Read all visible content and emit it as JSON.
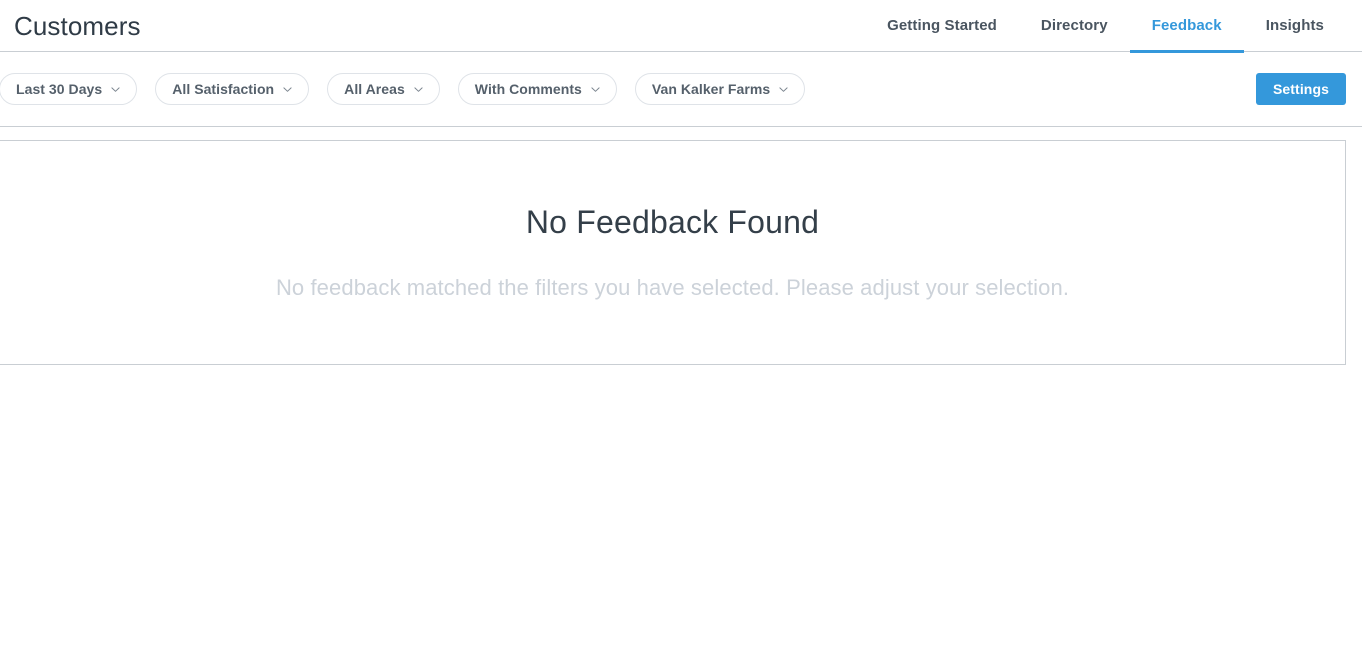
{
  "header": {
    "title": "Customers",
    "tabs": [
      {
        "label": "Getting Started",
        "active": false
      },
      {
        "label": "Directory",
        "active": false
      },
      {
        "label": "Feedback",
        "active": true
      },
      {
        "label": "Insights",
        "active": false
      }
    ]
  },
  "filters": {
    "pills": [
      {
        "label": "Last 30 Days",
        "icon": "chevron-down-icon"
      },
      {
        "label": "All Satisfaction",
        "icon": "chevron-down-icon"
      },
      {
        "label": "All Areas",
        "icon": "chevron-down-icon"
      },
      {
        "label": "With Comments",
        "icon": "chevron-down-icon"
      },
      {
        "label": "Van Kalker Farms",
        "icon": "chevron-down-icon"
      }
    ],
    "settings_label": "Settings"
  },
  "empty_state": {
    "title": "No Feedback Found",
    "subtitle": "No feedback matched the filters you have selected. Please adjust your selection."
  },
  "colors": {
    "accent": "#3498db",
    "border": "#c9ced3",
    "pill_border": "#dfe3e8",
    "title_text": "#2f3b46",
    "muted_text": "#ccd2d9"
  }
}
